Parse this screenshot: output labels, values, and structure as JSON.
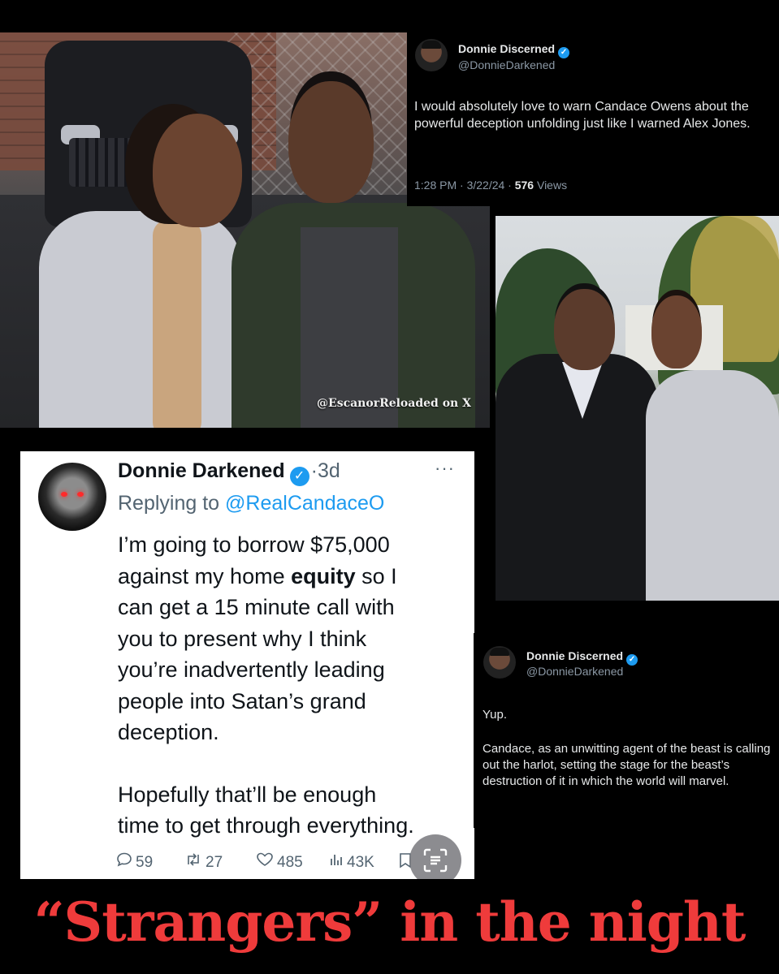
{
  "photo_top_left": {
    "watermark": "@EscanorReloaded on X"
  },
  "tweet_top": {
    "name": "Donnie Discerned",
    "handle": "@DonnieDarkened",
    "text": "I would absolutely love to warn Candace Owens about the powerful deception unfolding just like I warned Alex Jones.",
    "time": "1:28 PM · 3/22/24 ·",
    "views_count": "576",
    "views_label": "Views",
    "verified": true
  },
  "tweet_reply": {
    "name": "Donnie Darkened",
    "separator": "·",
    "age": "3d",
    "more": "···",
    "replying_prefix": "Replying to",
    "mention": "@RealCandaceO",
    "body_lines": [
      "I’m going to borrow $75,000",
      "against my home",
      "equity",
      "so I",
      "can get a 15 minute call with",
      "you to present why I think",
      "you’re inadvertently leading",
      "people into Satan’s grand",
      "deception."
    ],
    "body_lines_2": [
      "Hopefully that’ll be enough",
      "time to get through everything."
    ],
    "replies": "59",
    "reposts": "27",
    "likes": "485",
    "views": "43K",
    "verified": true
  },
  "tweet_bottom": {
    "name": "Donnie Discerned",
    "handle": "@DonnieDarkened",
    "text_1": "Yup.",
    "text_2": "Candace, as an unwitting agent of the beast is calling out the harlot, setting the stage for the beast’s destruction of it in which the world will marvel.",
    "verified": true
  },
  "caption": "“Strangers” in the night",
  "colors": {
    "caption_red": "#ef3b3b",
    "verified_blue": "#1d9bf0",
    "dark_bg": "#000000",
    "light_card": "#ffffff"
  }
}
